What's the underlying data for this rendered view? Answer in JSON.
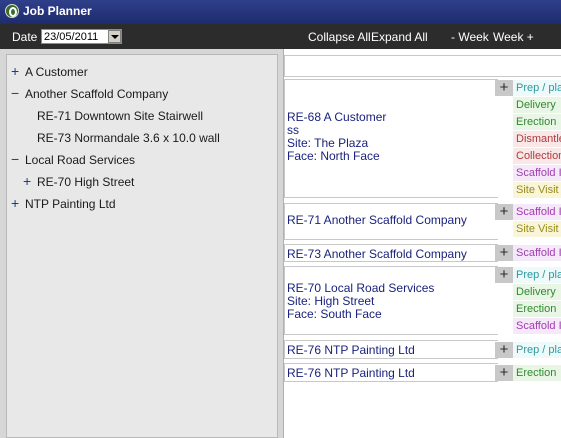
{
  "window": {
    "title": "Job Planner"
  },
  "toolbar": {
    "date_label": "Date",
    "date_value": "23/05/2011",
    "collapse_all": "Collapse All",
    "expand_all": "Expand All",
    "prev_week": "- Week",
    "next_week": "Week +"
  },
  "tree": {
    "items": [
      {
        "label": "A Customer",
        "toggle": "+"
      },
      {
        "label": "Another Scaffold Company",
        "toggle": "−"
      },
      {
        "label": "RE-71 Downtown Site Stairwell",
        "toggle": ""
      },
      {
        "label": "RE-73 Normandale 3.6 x 10.0 wall",
        "toggle": ""
      },
      {
        "label": "Local Road Services",
        "toggle": "−"
      },
      {
        "label": "RE-70 High Street",
        "toggle": "+"
      },
      {
        "label": "NTP Painting Ltd",
        "toggle": "+"
      }
    ]
  },
  "jobs": [
    {
      "lines": [
        "RE-68 A Customer",
        "ss",
        "Site: The Plaza",
        "Face: North Face"
      ],
      "tasks": [
        "Prep / pla",
        "Delivery",
        "Erection",
        "Dismantle",
        "Collection",
        "Scaffold I",
        "Site Visit"
      ]
    },
    {
      "lines": [
        "RE-71 Another Scaffold Company"
      ],
      "tasks": [
        "Scaffold I",
        "Site Visit"
      ]
    },
    {
      "lines": [
        "RE-73 Another Scaffold Company"
      ],
      "tasks": [
        "Scaffold I"
      ]
    },
    {
      "lines": [
        "RE-70 Local Road Services",
        "Site: High Street",
        "Face: South Face"
      ],
      "tasks": [
        "Prep / pla",
        "Delivery",
        "Erection",
        "Scaffold I"
      ]
    },
    {
      "lines": [
        "RE-76 NTP Painting Ltd"
      ],
      "tasks": [
        "Prep / pla"
      ]
    },
    {
      "lines": [
        "RE-76 NTP Painting Ltd"
      ],
      "tasks": [
        "Erection"
      ]
    }
  ],
  "add_label": "+",
  "colors": {
    "titlebar": "#1e2c6e",
    "toolbar": "#2c2c2c",
    "pane": "#e8e8e8",
    "job_text": "#1a237e"
  }
}
